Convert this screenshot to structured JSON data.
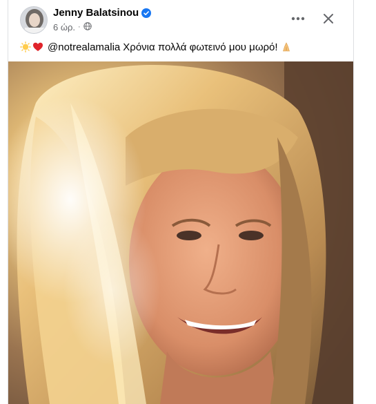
{
  "post": {
    "author": {
      "name": "Jenny Balatsinou",
      "verified": true
    },
    "time": "6 ώρ.",
    "separator": "·",
    "audience_icon": "globe-icon",
    "caption": {
      "emojis": [
        "sun-emoji",
        "red-heart-emoji"
      ],
      "mention": "@notrealamalia",
      "text": "Χρόνια πολλά φωτεινό μου μωρό!",
      "trailing_emoji": "folded-hands-emoji"
    },
    "actions": {
      "more_icon": "more-options-icon",
      "close_icon": "close-icon"
    },
    "photo": {
      "subject": "smiling blonde woman in sunlight"
    }
  },
  "colors": {
    "verified_blue": "#1877f2",
    "text_primary": "#050505",
    "text_secondary": "#65676b",
    "border": "#dddfe2"
  }
}
